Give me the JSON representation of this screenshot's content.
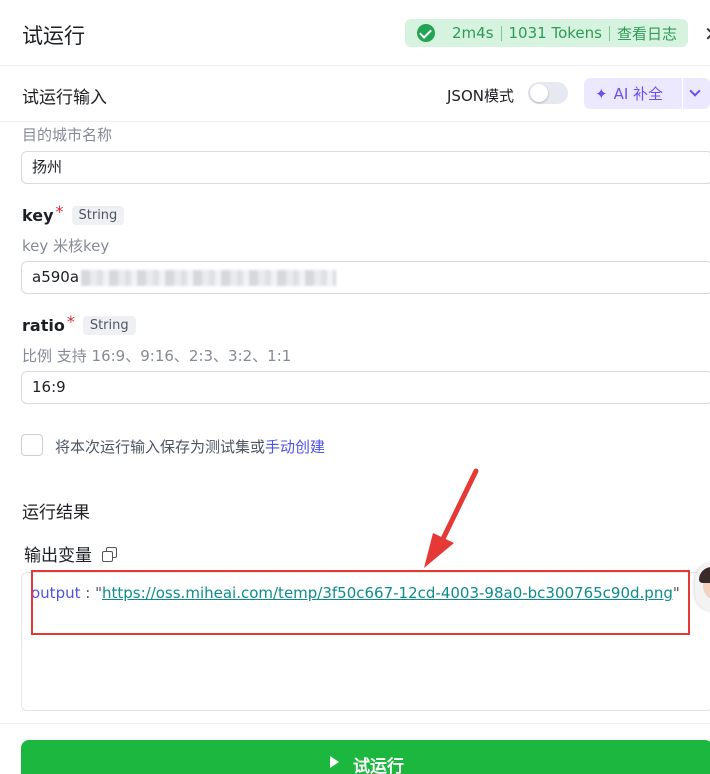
{
  "header": {
    "title": "试运行",
    "status": {
      "duration": "2m4s",
      "tokens": "1031 Tokens",
      "log_link": "查看日志"
    }
  },
  "input_panel": {
    "title": "试运行输入",
    "json_mode_label": "JSON模式",
    "json_mode_on": false,
    "ai_button_label": "AI 补全"
  },
  "fields": {
    "city": {
      "hint": "目的城市名称",
      "value": "扬州"
    },
    "key": {
      "label": "key",
      "type": "String",
      "hint": "key 米核key",
      "value": "a590a"
    },
    "ratio": {
      "label": "ratio",
      "type": "String",
      "hint": "比例 支持 16:9、9:16、2:3、3:2、1:1",
      "value": "16:9"
    }
  },
  "save": {
    "checked": false,
    "text": "将本次运行输入保存为测试集或",
    "link": "手动创建"
  },
  "result": {
    "section_title": "运行结果",
    "output_title": "输出变量",
    "output_key": "output",
    "output_url": "https://oss.miheai.com/temp/3f50c667-12cd-4003-98a0-bc300765c90d.png"
  },
  "footer": {
    "run_label": "试运行"
  },
  "colors": {
    "accent": "#4d53e8",
    "run_green": "#1cb73e",
    "status_green": "#2e9b55",
    "highlight_red": "#e53935"
  }
}
